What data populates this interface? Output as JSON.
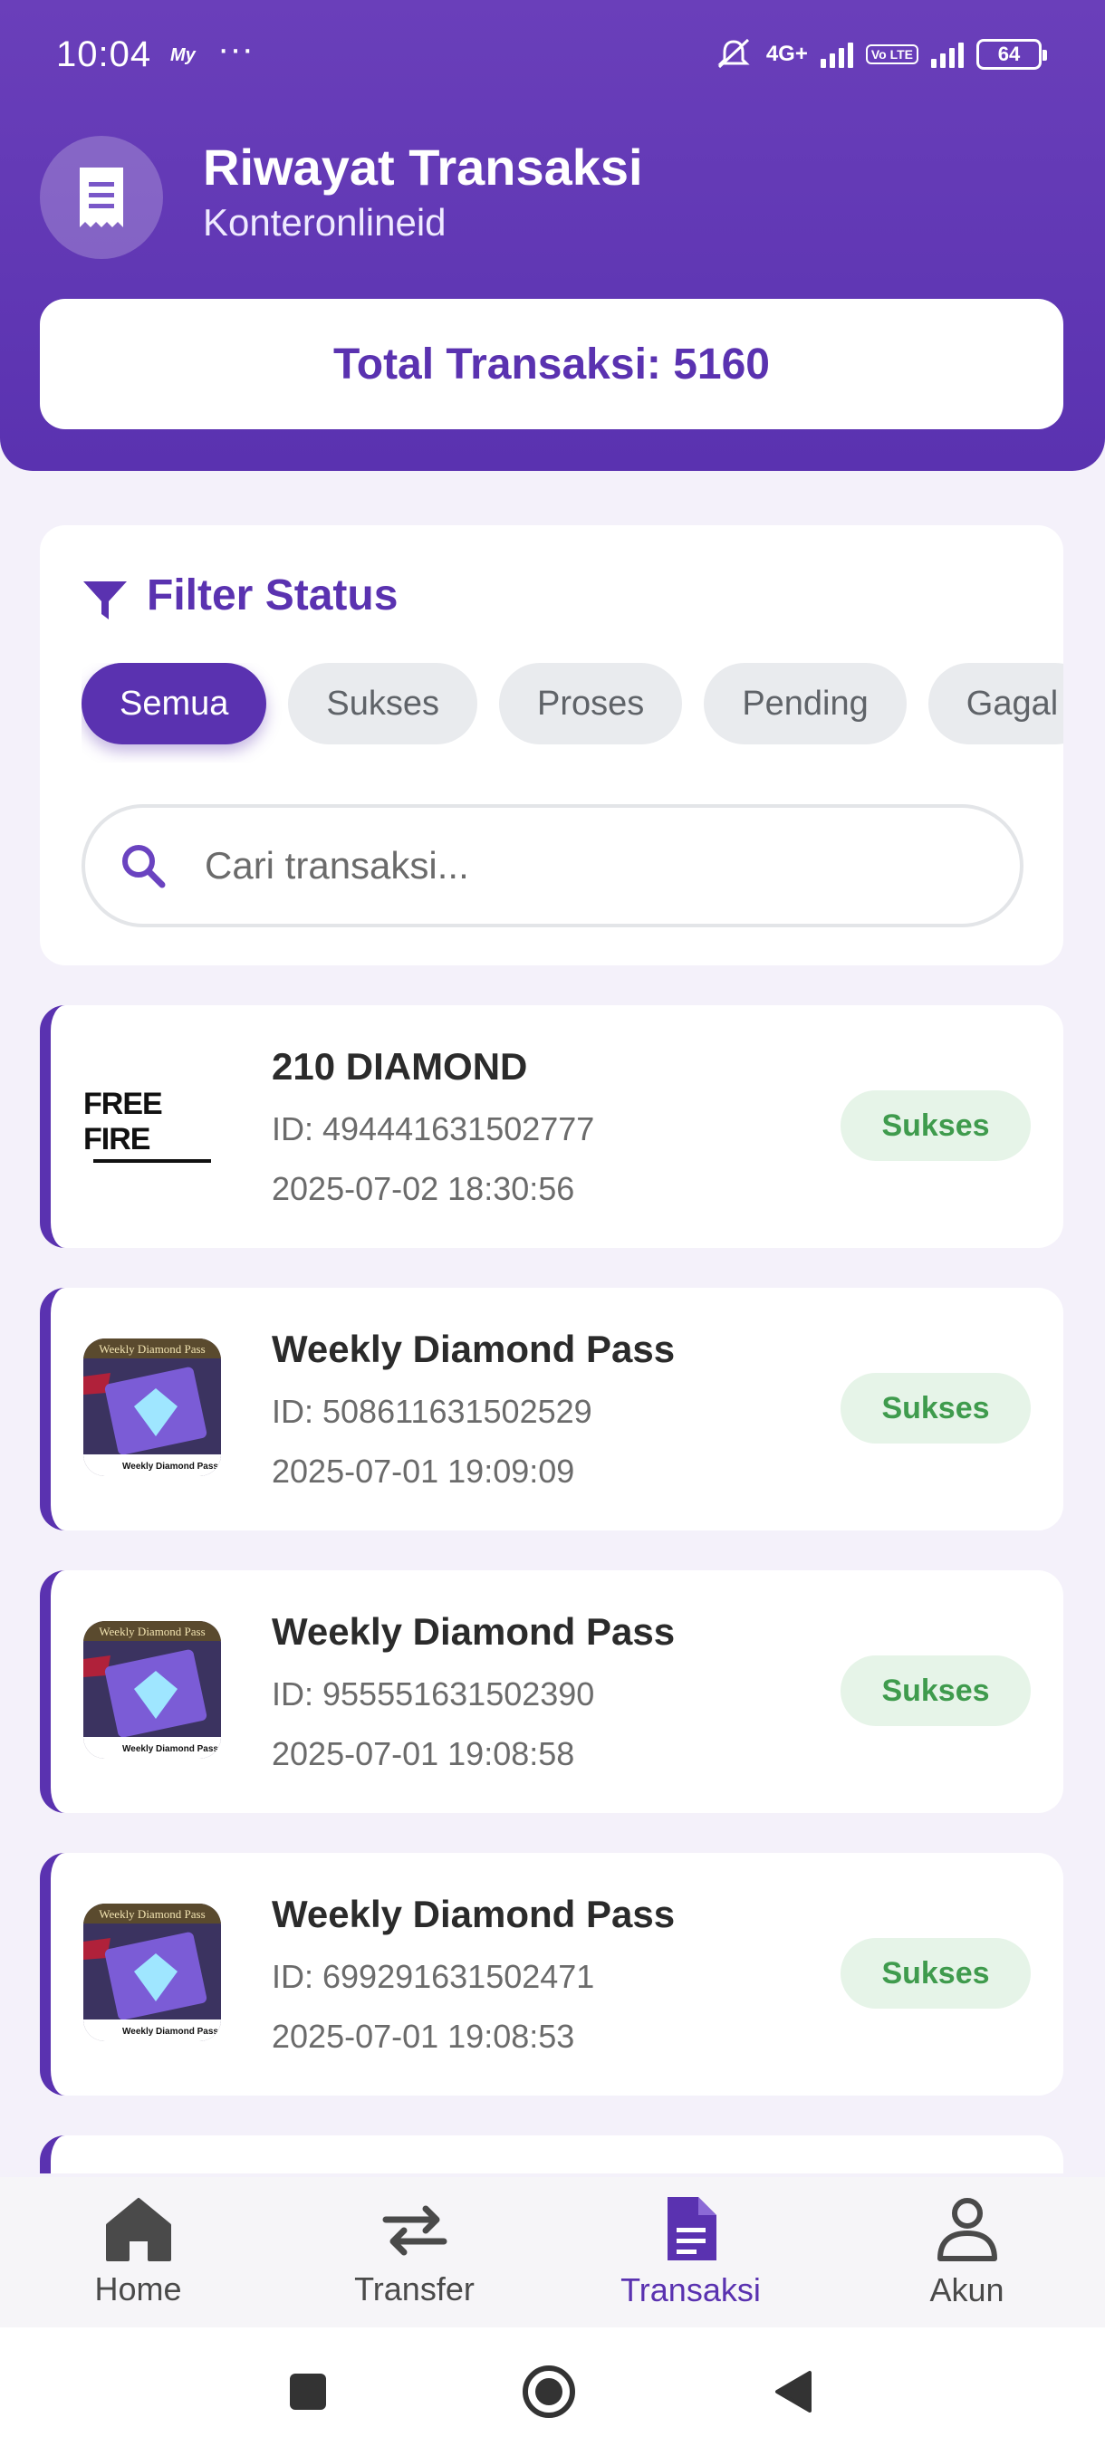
{
  "status_bar": {
    "time": "10:04",
    "carrier_badge": "My",
    "more": "···",
    "network": "4G+",
    "volte": "Vo LTE",
    "battery": "64"
  },
  "header": {
    "title": "Riwayat Transaksi",
    "subtitle": "Konteronlineid",
    "total_label": "Total Transaksi: 5160",
    "icon": "receipt-icon"
  },
  "filter": {
    "title": "Filter Status",
    "icon": "funnel-icon",
    "chips": [
      {
        "label": "Semua",
        "active": true
      },
      {
        "label": "Sukses",
        "active": false
      },
      {
        "label": "Proses",
        "active": false
      },
      {
        "label": "Pending",
        "active": false
      },
      {
        "label": "Gagal",
        "active": false
      }
    ],
    "search_placeholder": "Cari transaksi..."
  },
  "transactions": [
    {
      "name": "210 DIAMOND",
      "id": "ID: 494441631502777",
      "date": "2025-07-02 18:30:56",
      "status": "Sukses",
      "thumb": "free-fire-logo",
      "thumb_text": "FREE FIRE"
    },
    {
      "name": "Weekly Diamond Pass",
      "id": "ID: 508611631502529",
      "date": "2025-07-01 19:09:09",
      "status": "Sukses",
      "thumb": "weekly-diamond-pass-image",
      "thumb_text": "Weekly Diamond Pass"
    },
    {
      "name": "Weekly Diamond Pass",
      "id": "ID: 955551631502390",
      "date": "2025-07-01 19:08:58",
      "status": "Sukses",
      "thumb": "weekly-diamond-pass-image",
      "thumb_text": "Weekly Diamond Pass"
    },
    {
      "name": "Weekly Diamond Pass",
      "id": "ID: 699291631502471",
      "date": "2025-07-01 19:08:53",
      "status": "Sukses",
      "thumb": "weekly-diamond-pass-image",
      "thumb_text": "Weekly Diamond Pass"
    }
  ],
  "bottom_nav": [
    {
      "label": "Home",
      "icon": "home-icon",
      "active": false
    },
    {
      "label": "Transfer",
      "icon": "transfer-arrows-icon",
      "active": false
    },
    {
      "label": "Transaksi",
      "icon": "document-icon",
      "active": true
    },
    {
      "label": "Akun",
      "icon": "person-icon",
      "active": false
    }
  ],
  "colors": {
    "primary": "#5a32b0",
    "success_bg": "#e6f4e8",
    "success_text": "#3f9b4d"
  }
}
